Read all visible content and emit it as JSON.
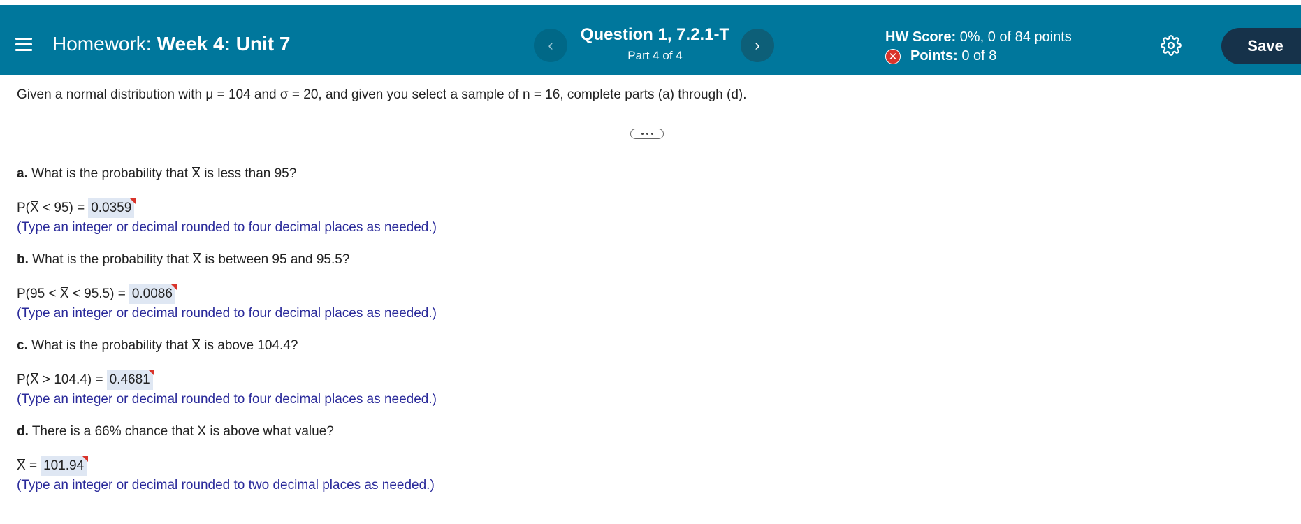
{
  "header": {
    "hw_label": "Homework:",
    "hw_name": "Week 4: Unit 7",
    "question_title": "Question 1, 7.2.1-T",
    "question_part": "Part 4 of 4",
    "score_label": "HW Score:",
    "score_value": "0%, 0 of 84 points",
    "points_label": "Points:",
    "points_value": "0 of 8",
    "save_label": "Save",
    "prev_glyph": "‹",
    "next_glyph": "›",
    "status_glyph": "✕",
    "icons": [
      "menu-icon",
      "chevron-left-icon",
      "chevron-right-icon",
      "incorrect-icon",
      "gear-icon"
    ],
    "colors": {
      "header_bg": "#00779c",
      "save_bg": "#16324a",
      "error_red": "#d9342b"
    }
  },
  "prompt": "Given a normal distribution with μ = 104 and σ = 20, and given you select a sample of n = 16, complete parts (a) through (d).",
  "parts": [
    {
      "label": "a.",
      "question_pre": "What is the probability that",
      "question_post": "is less than 95?",
      "answer_pre": "P(",
      "answer_post": "< 95) =",
      "answer": "0.0359",
      "hint": "(Type an integer or decimal rounded to four decimal places as needed.)"
    },
    {
      "label": "b.",
      "question_pre": "What is the probability that",
      "question_post": "is between 95 and 95.5?",
      "answer_pre": "P(95 <",
      "answer_post": "< 95.5) =",
      "answer": "0.0086",
      "hint": "(Type an integer or decimal rounded to four decimal places as needed.)"
    },
    {
      "label": "c.",
      "question_pre": "What is the probability that",
      "question_post": "is above 104.4?",
      "answer_pre": "P(",
      "answer_post": "> 104.4) =",
      "answer": "0.4681",
      "hint": "(Type an integer or decimal rounded to four decimal places as needed.)"
    },
    {
      "label": "d.",
      "question_pre": "There is a 66% chance that",
      "question_post": "is above what value?",
      "answer_pre": "",
      "answer_post": "=",
      "answer": "101.94",
      "hint": "(Type an integer or decimal rounded to two decimal places as needed.)"
    }
  ],
  "xbar_symbol": "X"
}
